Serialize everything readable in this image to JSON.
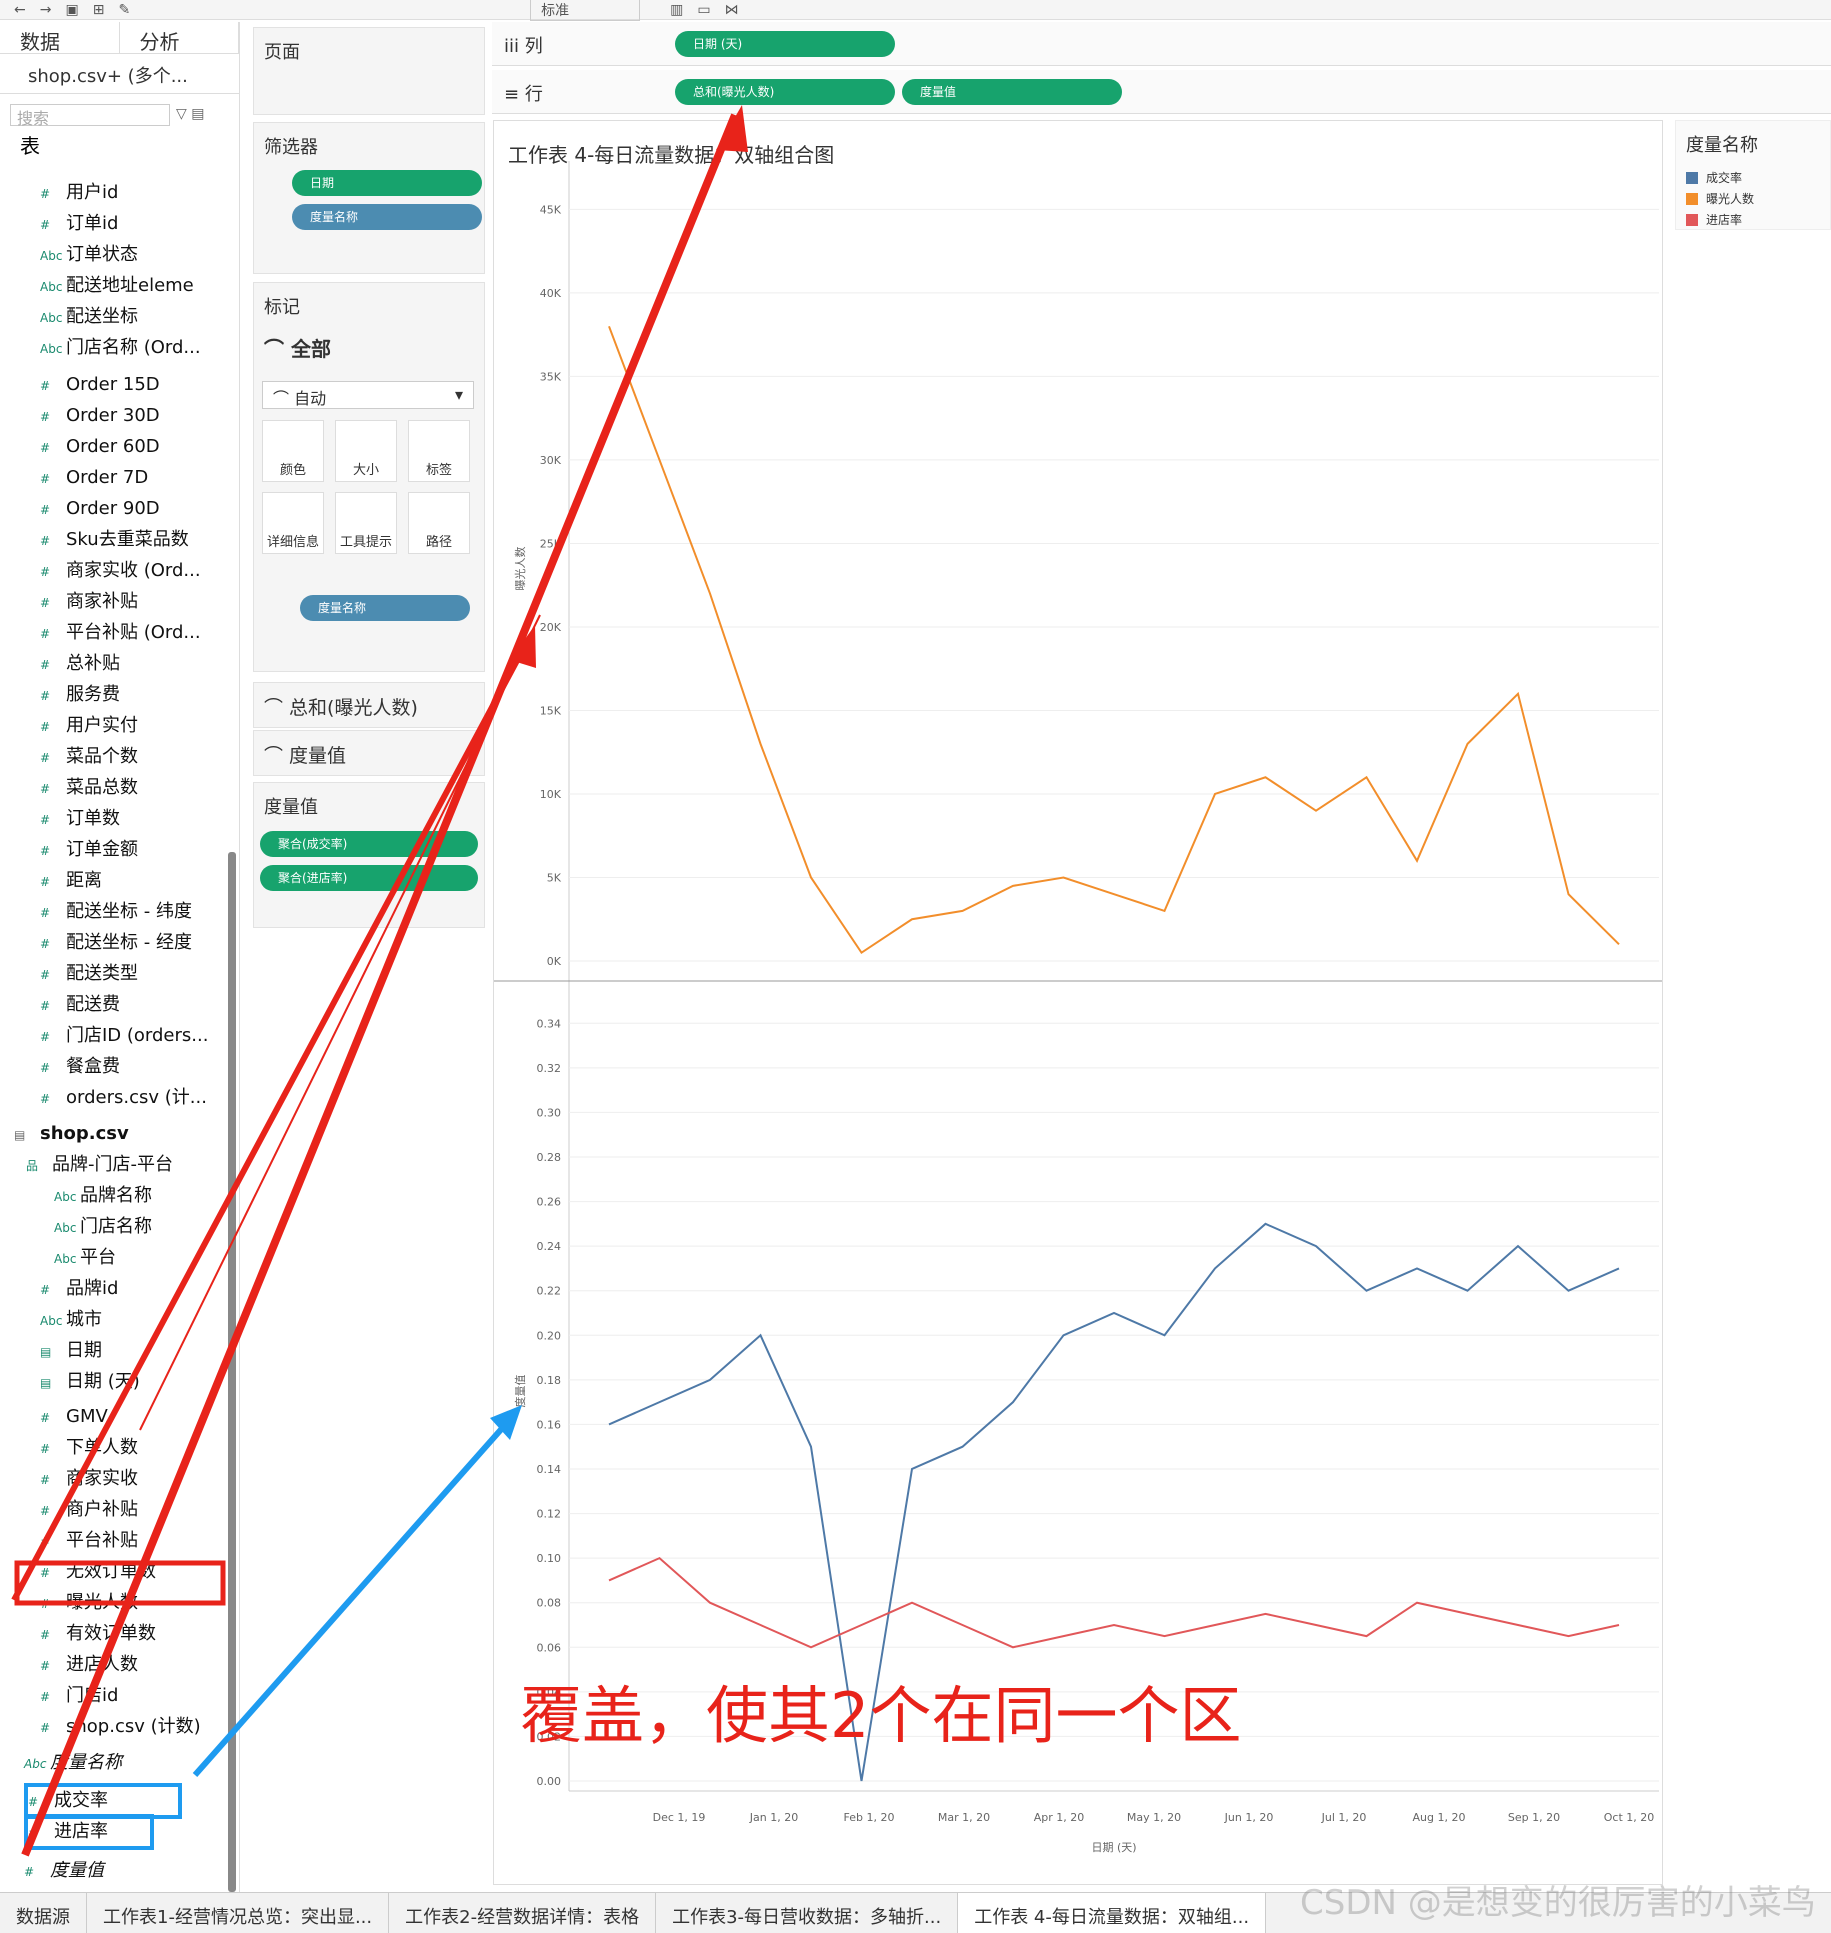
{
  "toolbar": {
    "mode_label": "标准"
  },
  "left_panel": {
    "tab_data": "数据",
    "tab_analysis": "分析",
    "datasource": "shop.csv+ (多个...",
    "search_placeholder": "搜索",
    "table_heading": "表",
    "order_fields": [
      "用户id",
      "订单id",
      "订单状态",
      "配送地址eleme",
      "配送坐标",
      "门店名称 (Ord...",
      "Order 15D",
      "Order 30D",
      "Order 60D",
      "Order 7D",
      "Order 90D",
      "Sku去重菜品数",
      "商家实收 (Ord...",
      "商家补贴",
      "平台补贴 (Ord...",
      "总补贴",
      "服务费",
      "用户实付",
      "菜品个数",
      "菜品总数",
      "订单数",
      "订单金额",
      "距离",
      "配送坐标 - 纬度",
      "配送坐标 - 经度",
      "配送类型",
      "配送费",
      "门店ID (orders...",
      "餐盒费",
      "orders.csv (计..."
    ],
    "shop_table": "shop.csv",
    "hierarchy": "品牌-门店-平台",
    "hierarchy_items": [
      "品牌名称",
      "门店名称",
      "平台"
    ],
    "shop_fields": [
      "品牌id",
      "城市",
      "日期",
      "日期 (天)",
      "GMV",
      "下单人数",
      "商家实收",
      "商户补贴",
      "平台补贴",
      "无效订单数",
      "曝光人数",
      "有效订单数",
      "进店人数",
      "门店id",
      "shop.csv (计数)"
    ],
    "measure_names": "度量名称",
    "calc_fields": [
      "成交率",
      "进店率"
    ],
    "measure_values": "度量值"
  },
  "middle_panel": {
    "pages": "页面",
    "filters": "筛选器",
    "filter_pills": [
      "日期",
      "度量名称"
    ],
    "marks": "标记",
    "marks_all": "全部",
    "mark_type": "自动",
    "mark_buttons": [
      "颜色",
      "大小",
      "标签",
      "详细信息",
      "工具提示",
      "路径"
    ],
    "color_pill": "度量名称",
    "card_sum": "总和(曝光人数)",
    "card_mv": "度量值",
    "mv_section": "度量值",
    "mv_pills": [
      "聚合(成交率)",
      "聚合(进店率)"
    ]
  },
  "shelves": {
    "columns_label": "列",
    "columns_pill": "日期 (天)",
    "rows_label": "行",
    "rows_pills": [
      "总和(曝光人数)",
      "度量值"
    ]
  },
  "legend": {
    "title": "度量名称",
    "items": [
      {
        "name": "成交率",
        "color": "#4e79a7"
      },
      {
        "name": "曝光人数",
        "color": "#f28e2b"
      },
      {
        "name": "进店率",
        "color": "#e15759"
      }
    ]
  },
  "annotation_text": "覆盖，使其2个在同一个区",
  "watermark": "CSDN @是想变的很厉害的小菜鸟",
  "sheet_tabs": [
    "数据源",
    "工作表1-经营情况总览：突出显...",
    "工作表2-经营数据详情：表格",
    "工作表3-每日营收数据：多轴折...",
    "工作表 4-每日流量数据：双轴组..."
  ],
  "chart_data": [
    {
      "type": "line",
      "title": "工作表 4-每日流量数据：双轴组合图",
      "xlabel": "日期 (天)",
      "ylabel": "曝光人数",
      "ylim": [
        0,
        47000
      ],
      "yticks": [
        "0K",
        "5K",
        "10K",
        "15K",
        "20K",
        "25K",
        "30K",
        "35K",
        "40K",
        "45K"
      ],
      "x": [
        "2019-12-01",
        "2019-12-15",
        "2020-01-01",
        "2020-01-15",
        "2020-02-01",
        "2020-02-15",
        "2020-03-01",
        "2020-03-15",
        "2020-04-01",
        "2020-04-15",
        "2020-05-01",
        "2020-05-15",
        "2020-06-01",
        "2020-06-15",
        "2020-07-01",
        "2020-07-15",
        "2020-08-01",
        "2020-08-15",
        "2020-09-01",
        "2020-09-15",
        "2020-10-01"
      ],
      "series": [
        {
          "name": "曝光人数",
          "color": "#f28e2b",
          "values": [
            38000,
            30000,
            22000,
            13000,
            5000,
            500,
            2500,
            3000,
            4500,
            5000,
            4000,
            3000,
            10000,
            11000,
            9000,
            11000,
            6000,
            13000,
            16000,
            4000,
            1000
          ]
        }
      ]
    },
    {
      "type": "line",
      "xlabel": "日期 (天)",
      "ylabel": "度量值",
      "ylim": [
        0,
        0.35
      ],
      "yticks": [
        "0.00",
        "0.02",
        "0.04",
        "0.06",
        "0.08",
        "0.10",
        "0.12",
        "0.14",
        "0.16",
        "0.18",
        "0.20",
        "0.22",
        "0.24",
        "0.26",
        "0.28",
        "0.30",
        "0.32",
        "0.34"
      ],
      "xticks": [
        "Dec 1, 19",
        "Jan 1, 20",
        "Feb 1, 20",
        "Mar 1, 20",
        "Apr 1, 20",
        "May 1, 20",
        "Jun 1, 20",
        "Jul 1, 20",
        "Aug 1, 20",
        "Sep 1, 20",
        "Oct 1, 20"
      ],
      "x": [
        "2019-12-01",
        "2019-12-15",
        "2020-01-01",
        "2020-01-15",
        "2020-02-01",
        "2020-02-15",
        "2020-03-01",
        "2020-03-15",
        "2020-04-01",
        "2020-04-15",
        "2020-05-01",
        "2020-05-15",
        "2020-06-01",
        "2020-06-15",
        "2020-07-01",
        "2020-07-15",
        "2020-08-01",
        "2020-08-15",
        "2020-09-01",
        "2020-09-15",
        "2020-10-01"
      ],
      "series": [
        {
          "name": "成交率",
          "color": "#4e79a7",
          "values": [
            0.16,
            0.17,
            0.18,
            0.2,
            0.15,
            0.0,
            0.14,
            0.15,
            0.17,
            0.2,
            0.21,
            0.2,
            0.23,
            0.25,
            0.24,
            0.22,
            0.23,
            0.22,
            0.24,
            0.22,
            0.23
          ]
        },
        {
          "name": "进店率",
          "color": "#e15759",
          "values": [
            0.09,
            0.1,
            0.08,
            0.07,
            0.06,
            0.07,
            0.08,
            0.07,
            0.06,
            0.065,
            0.07,
            0.065,
            0.07,
            0.075,
            0.07,
            0.065,
            0.08,
            0.075,
            0.07,
            0.065,
            0.07
          ]
        }
      ]
    }
  ]
}
